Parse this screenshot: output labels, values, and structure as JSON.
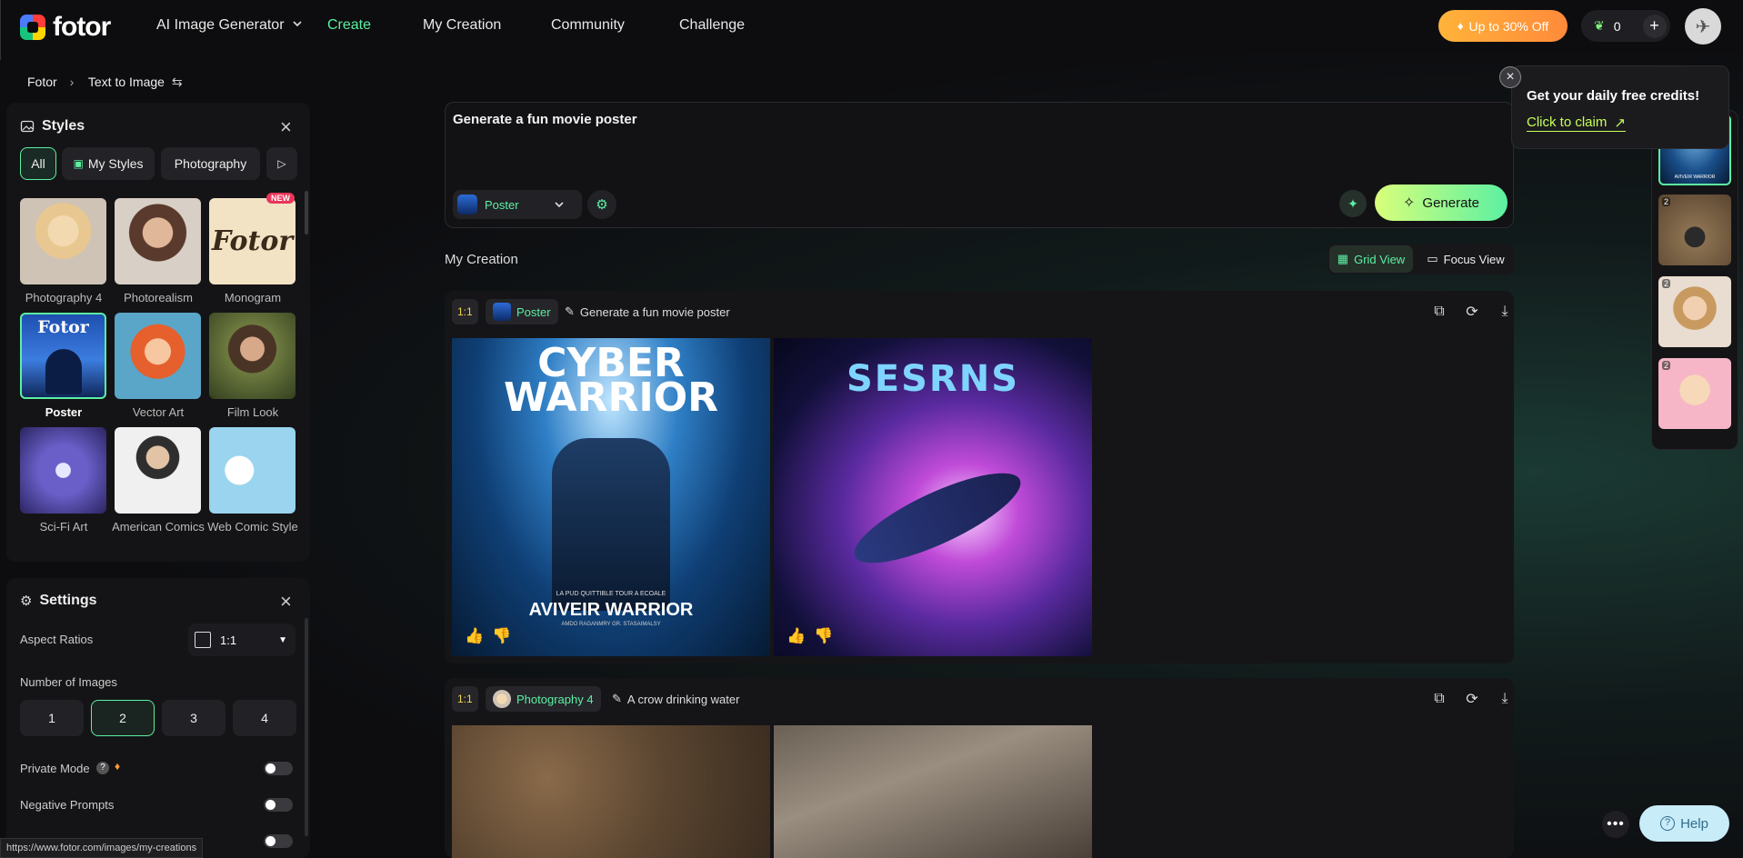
{
  "app": {
    "brand": "fotor"
  },
  "nav": {
    "product": "AI Image Generator",
    "items": [
      "Create",
      "My Creation",
      "Community",
      "Challenge"
    ],
    "promo": "Up to 30% Off",
    "credits": "0"
  },
  "breadcrumb": {
    "root": "Fotor",
    "current": "Text to Image"
  },
  "styles_panel": {
    "title": "Styles",
    "filters": [
      "All",
      "My Styles",
      "Photography"
    ],
    "items": [
      {
        "label": "Photography 4"
      },
      {
        "label": "Photorealism"
      },
      {
        "label": "Monogram",
        "badge": "NEW",
        "art_text": "Fotor"
      },
      {
        "label": "Poster",
        "art_text": "Fotor"
      },
      {
        "label": "Vector Art"
      },
      {
        "label": "Film Look"
      },
      {
        "label": "Sci-Fi Art"
      },
      {
        "label": "American Comics"
      },
      {
        "label": "Web Comic Style"
      }
    ]
  },
  "settings_panel": {
    "title": "Settings",
    "aspect_label": "Aspect Ratios",
    "aspect_value": "1:1",
    "num_images_label": "Number of Images",
    "num_options": [
      "1",
      "2",
      "3",
      "4"
    ],
    "num_selected": "2",
    "private_mode": "Private Mode",
    "negative_prompts": "Negative Prompts"
  },
  "prompt": {
    "text": "Generate a fun movie poster",
    "style": "Poster",
    "generate": "Generate"
  },
  "creation": {
    "title": "My Creation",
    "views": [
      "Grid View",
      "Focus View"
    ],
    "cards": [
      {
        "ratio": "1:1",
        "style": "Poster",
        "prompt": "Generate a fun movie poster",
        "images": [
          {
            "title_top": "CYBER",
            "title_bottom": "WARRIOR",
            "footer": "AVIVEIR WARRIOR",
            "small": "LA PUD QUITTIBLE TOUR A ECOALE",
            "sub": "AMDO RAGANMRY GR. STASAIMALSY"
          },
          {
            "title_top": "SESRNS"
          }
        ]
      },
      {
        "ratio": "1:1",
        "style": "Photography 4",
        "prompt": "A crow drinking water"
      }
    ]
  },
  "popup": {
    "title": "Get your daily free credits!",
    "link": "Click to claim"
  },
  "rail": {
    "counts": [
      "2",
      "2",
      "2"
    ],
    "thumb_text": "AVIVEIR WARRIOR"
  },
  "help": {
    "label": "Help"
  },
  "status_url": "https://www.fotor.com/images/my-creations",
  "colors": {
    "accent": "#5cf0a3",
    "promo": "#ff9a3a",
    "bg": "#0d0d10"
  }
}
